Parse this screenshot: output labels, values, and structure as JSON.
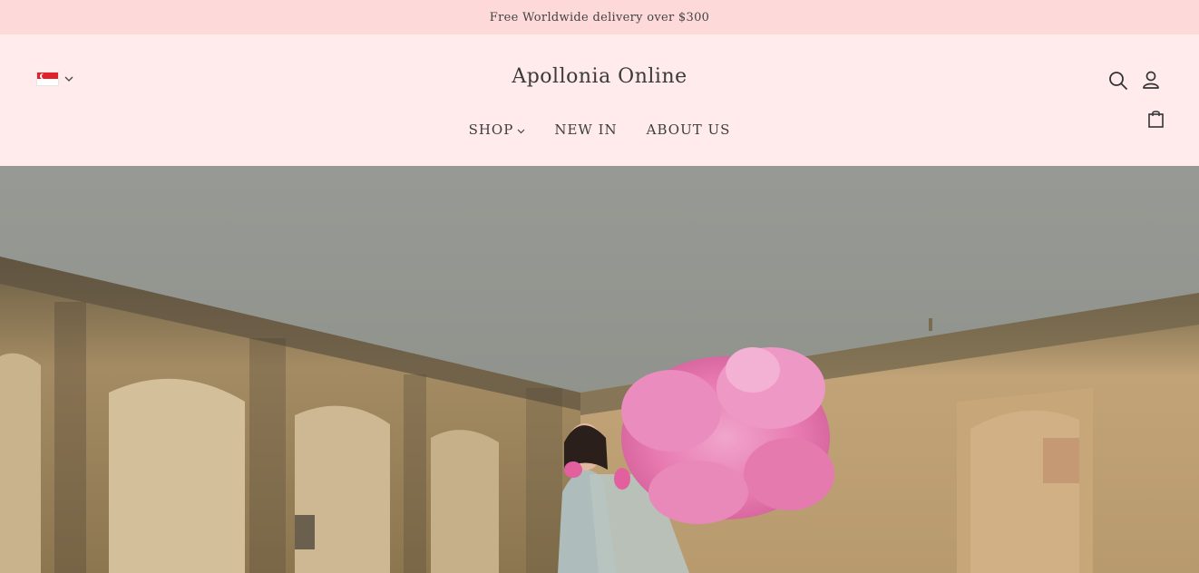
{
  "announcement": {
    "text": "Free Worldwide delivery over $300"
  },
  "header": {
    "brand": "Apollonia Online",
    "locale": {
      "flag_icon": "singapore-flag-icon",
      "chevron_icon": "chevron-down-icon"
    },
    "nav": [
      {
        "label": "SHOP",
        "has_dropdown": true
      },
      {
        "label": "NEW IN",
        "has_dropdown": false
      },
      {
        "label": "ABOUT US",
        "has_dropdown": false
      }
    ],
    "icons": {
      "search": "search-icon",
      "account": "user-icon",
      "cart": "shopping-bag-icon"
    }
  },
  "hero": {
    "image_icon": "hero-photo",
    "colors": {
      "sky": "#969a94",
      "wall": "#b59a6e",
      "accent_pink": "#e77bb0"
    }
  },
  "colors": {
    "announcement_bg": "#fdd9d9",
    "header_bg": "#ffebeb",
    "text": "#3b3b3b"
  }
}
